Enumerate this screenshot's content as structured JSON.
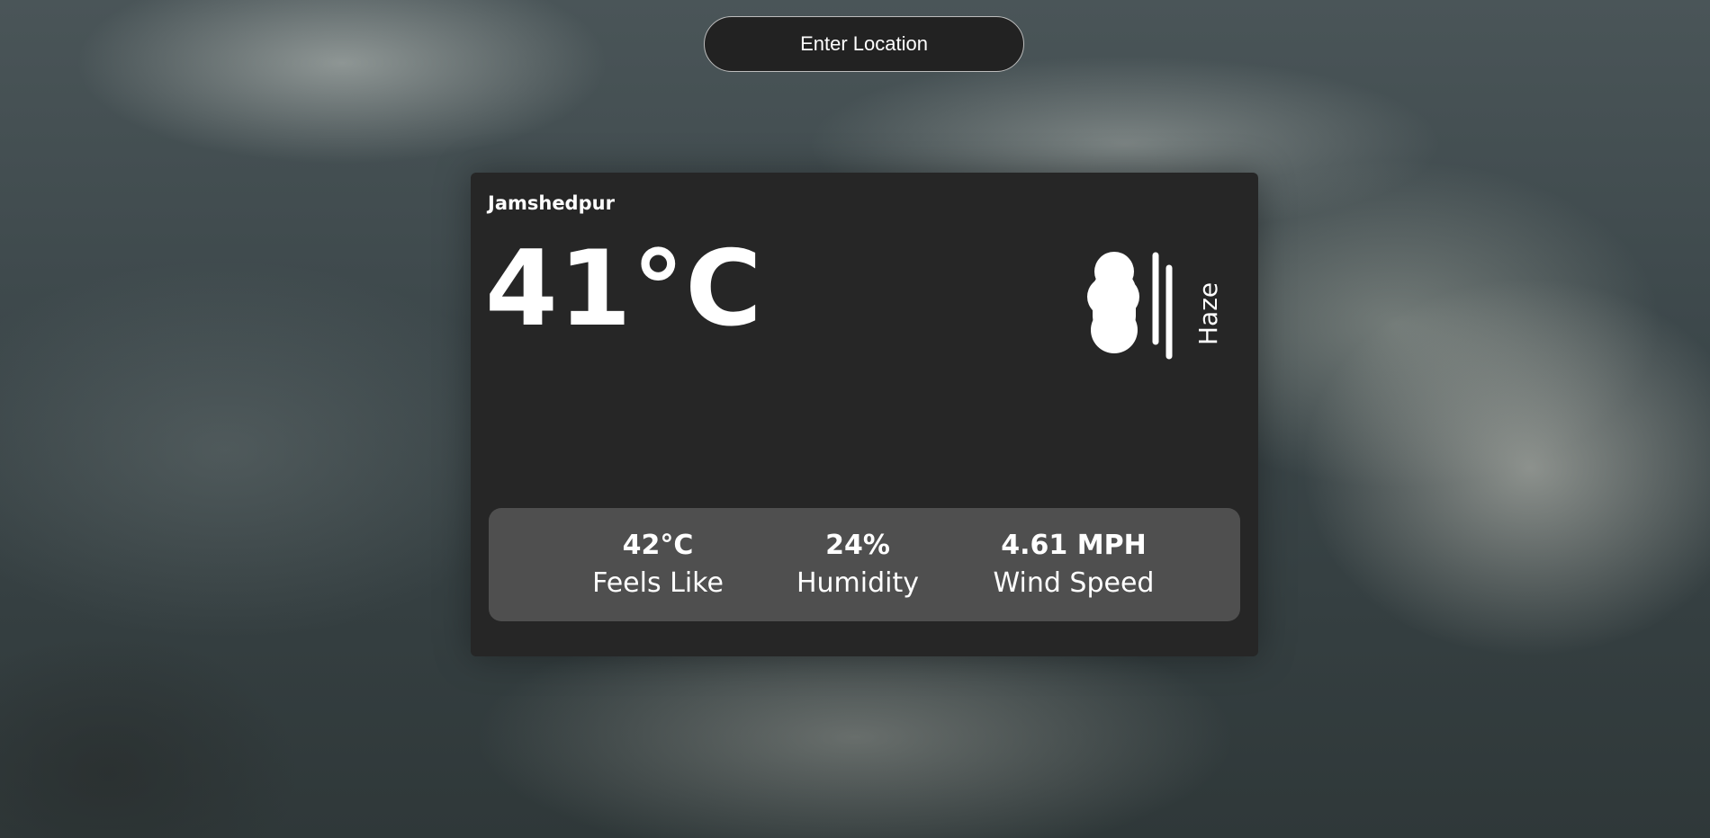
{
  "search": {
    "placeholder": "Enter Location"
  },
  "weather": {
    "city": "Jamshedpur",
    "temperature": "41°C",
    "condition": "Haze",
    "condition_icon": "haze-icon"
  },
  "stats": [
    {
      "value": "42°C",
      "label": "Feels Like"
    },
    {
      "value": "24%",
      "label": "Humidity"
    },
    {
      "value": "4.61 MPH",
      "label": "Wind Speed"
    }
  ],
  "colors": {
    "card_bg": "#262626",
    "stats_bg": "#4f4f4f",
    "text": "#ffffff"
  }
}
